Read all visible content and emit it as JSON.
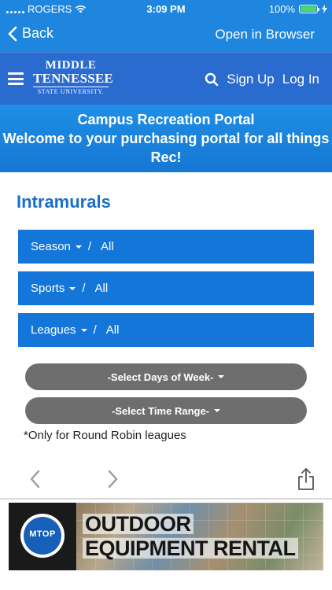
{
  "status_bar": {
    "carrier": "ROGERS",
    "time": "3:09 PM",
    "battery_percent": "100%",
    "battery_level": 1.0
  },
  "browser_bar": {
    "back_label": "Back",
    "open_in_browser_label": "Open in Browser"
  },
  "header": {
    "logo": {
      "line1": "MIDDLE",
      "line2": "TENNESSEE",
      "line3": "STATE UNIVERSITY."
    },
    "sign_up_label": "Sign Up",
    "log_in_label": "Log In"
  },
  "banner": {
    "title": "Campus Recreation Portal",
    "subtitle": "Welcome to your purchasing portal for all things Rec!"
  },
  "main": {
    "section_title": "Intramurals",
    "filters": [
      {
        "label": "Season",
        "value": "All"
      },
      {
        "label": "Sports",
        "value": "All"
      },
      {
        "label": "Leagues",
        "value": "All"
      }
    ],
    "separator": "/",
    "days_button_label": "-Select Days of Week-",
    "time_button_label": "-Select Time Range-",
    "note": "*Only for Round Robin leagues"
  },
  "ad": {
    "logo_text": "MTOP",
    "line1": "OUTDOOR",
    "line2": "EQUIPMENT RENTAL"
  },
  "colors": {
    "top_bar": "#1e86de",
    "site_header": "#2a6bd0",
    "filter_bg": "#1576da",
    "pill_bg": "#6e6e6e",
    "title_blue": "#1a6fc9"
  }
}
